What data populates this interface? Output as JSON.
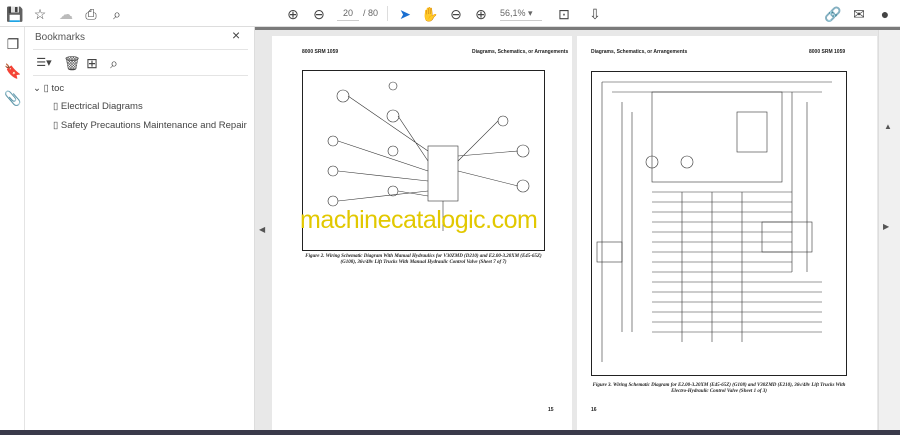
{
  "toolbar": {
    "page_current": "20",
    "page_total": "/ 80",
    "zoom": "56,1%"
  },
  "bookmarks": {
    "title": "Bookmarks",
    "items": [
      {
        "label": "toc"
      },
      {
        "label": "Electrical Diagrams"
      },
      {
        "label": "Safety Precautions Maintenance and Repair"
      }
    ]
  },
  "pages": [
    {
      "header_left": "8000 SRM 1059",
      "header_right": "Diagrams, Schematics, or Arrangements",
      "caption": "Figure 2. Wiring Schematic Diagram With Manual Hydraulics for V30ZMD (D210) and E2.00-3.20XM (E45-65Z) (G108), 36v/48v Lift Trucks With Manual Hydraulic Control Valve (Sheet 7 of 7)",
      "page_number": "15"
    },
    {
      "header_left": "Diagrams, Schematics, or Arrangements",
      "header_right": "8000 SRM 1059",
      "caption": "Figure 3. Wiring Schematic Diagram for E2.00-3.20XM (E45-65Z) (G108) and V30ZMD (E210), 36v/48v Lift Trucks With Electro-Hydraulic Control Valve (Sheet 1 of 3)",
      "page_number": "16"
    }
  ],
  "watermark": "machinecatalogic.com"
}
